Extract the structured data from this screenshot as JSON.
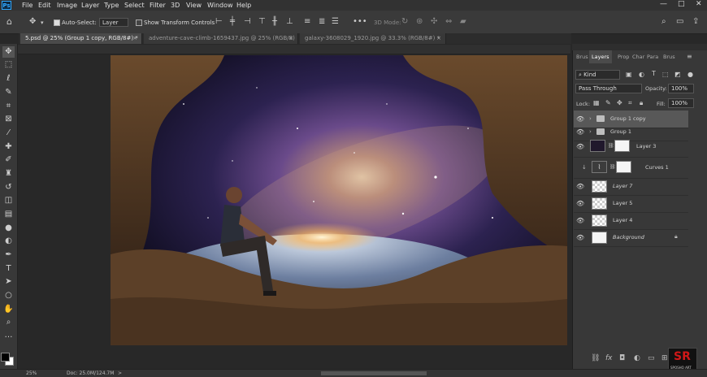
{
  "app": {
    "logo": "Ps",
    "accent": "#31a8ff"
  },
  "menu": [
    "File",
    "Edit",
    "Image",
    "Layer",
    "Type",
    "Select",
    "Filter",
    "3D",
    "View",
    "Window",
    "Help"
  ],
  "window_controls": {
    "minimize": "—",
    "maximize": "□",
    "close": "✕"
  },
  "options": {
    "auto_select_label": "Auto-Select:",
    "auto_select_value": "Layer",
    "transform_label": "Show Transform Controls",
    "mode_3d_label": "3D Mode:"
  },
  "tabs": [
    {
      "label": "5.psd @ 25% (Group 1 copy, RGB/8#) *",
      "close": "×"
    },
    {
      "label": "adventure-cave-climb-1659437.jpg @ 25% (RGB/8) *",
      "close": "×"
    },
    {
      "label": "galaxy-3608029_1920.jpg @ 33.3% (RGB/8#) *",
      "close": "×"
    }
  ],
  "tools": [
    "move-tool-icon",
    "marquee-tool-icon",
    "lasso-tool-icon",
    "quick-select-tool-icon",
    "crop-tool-icon",
    "frame-tool-icon",
    "eyedropper-tool-icon",
    "healing-brush-icon",
    "brush-tool-icon",
    "clone-stamp-icon",
    "history-brush-icon",
    "eraser-tool-icon",
    "gradient-tool-icon",
    "blur-tool-icon",
    "dodge-tool-icon",
    "pen-tool-icon",
    "type-tool-icon",
    "path-select-icon",
    "shape-tool-icon",
    "hand-tool-icon",
    "zoom-tool-icon",
    "more-tools-icon"
  ],
  "panel": {
    "tabs": [
      "Brus",
      "Layers",
      "Prop",
      "Char",
      "Para",
      "Brus"
    ],
    "filter_label": "Kind",
    "blend_mode": "Pass Through",
    "opacity_label": "Opacity:",
    "opacity_value": "100%",
    "lock_label": "Lock:",
    "fill_label": "Fill:",
    "fill_value": "100%",
    "layers": [
      {
        "name": "Group 1 copy",
        "kind": "group",
        "selected": true
      },
      {
        "name": "Group 1",
        "kind": "group",
        "selected": false
      },
      {
        "name": "Layer 3",
        "kind": "masked",
        "selected": false
      },
      {
        "name": "Curves 1",
        "kind": "adjustment",
        "selected": false
      },
      {
        "name": "Layer 7",
        "kind": "pixel",
        "selected": false
      },
      {
        "name": "Layer 5",
        "kind": "pixel",
        "selected": false
      },
      {
        "name": "Layer 4",
        "kind": "pixel",
        "selected": false
      },
      {
        "name": "Background",
        "kind": "background",
        "selected": false
      }
    ],
    "bottom_icons": [
      "link-icon",
      "fx-icon",
      "mask-icon",
      "adjustment-icon",
      "folder-icon",
      "new-layer-icon",
      "trash-icon"
    ]
  },
  "status": {
    "zoom": "25%",
    "doc": "Doc: 25.0M/124.7M",
    "arrow": ">"
  },
  "watermark": "SPOSHO ART"
}
